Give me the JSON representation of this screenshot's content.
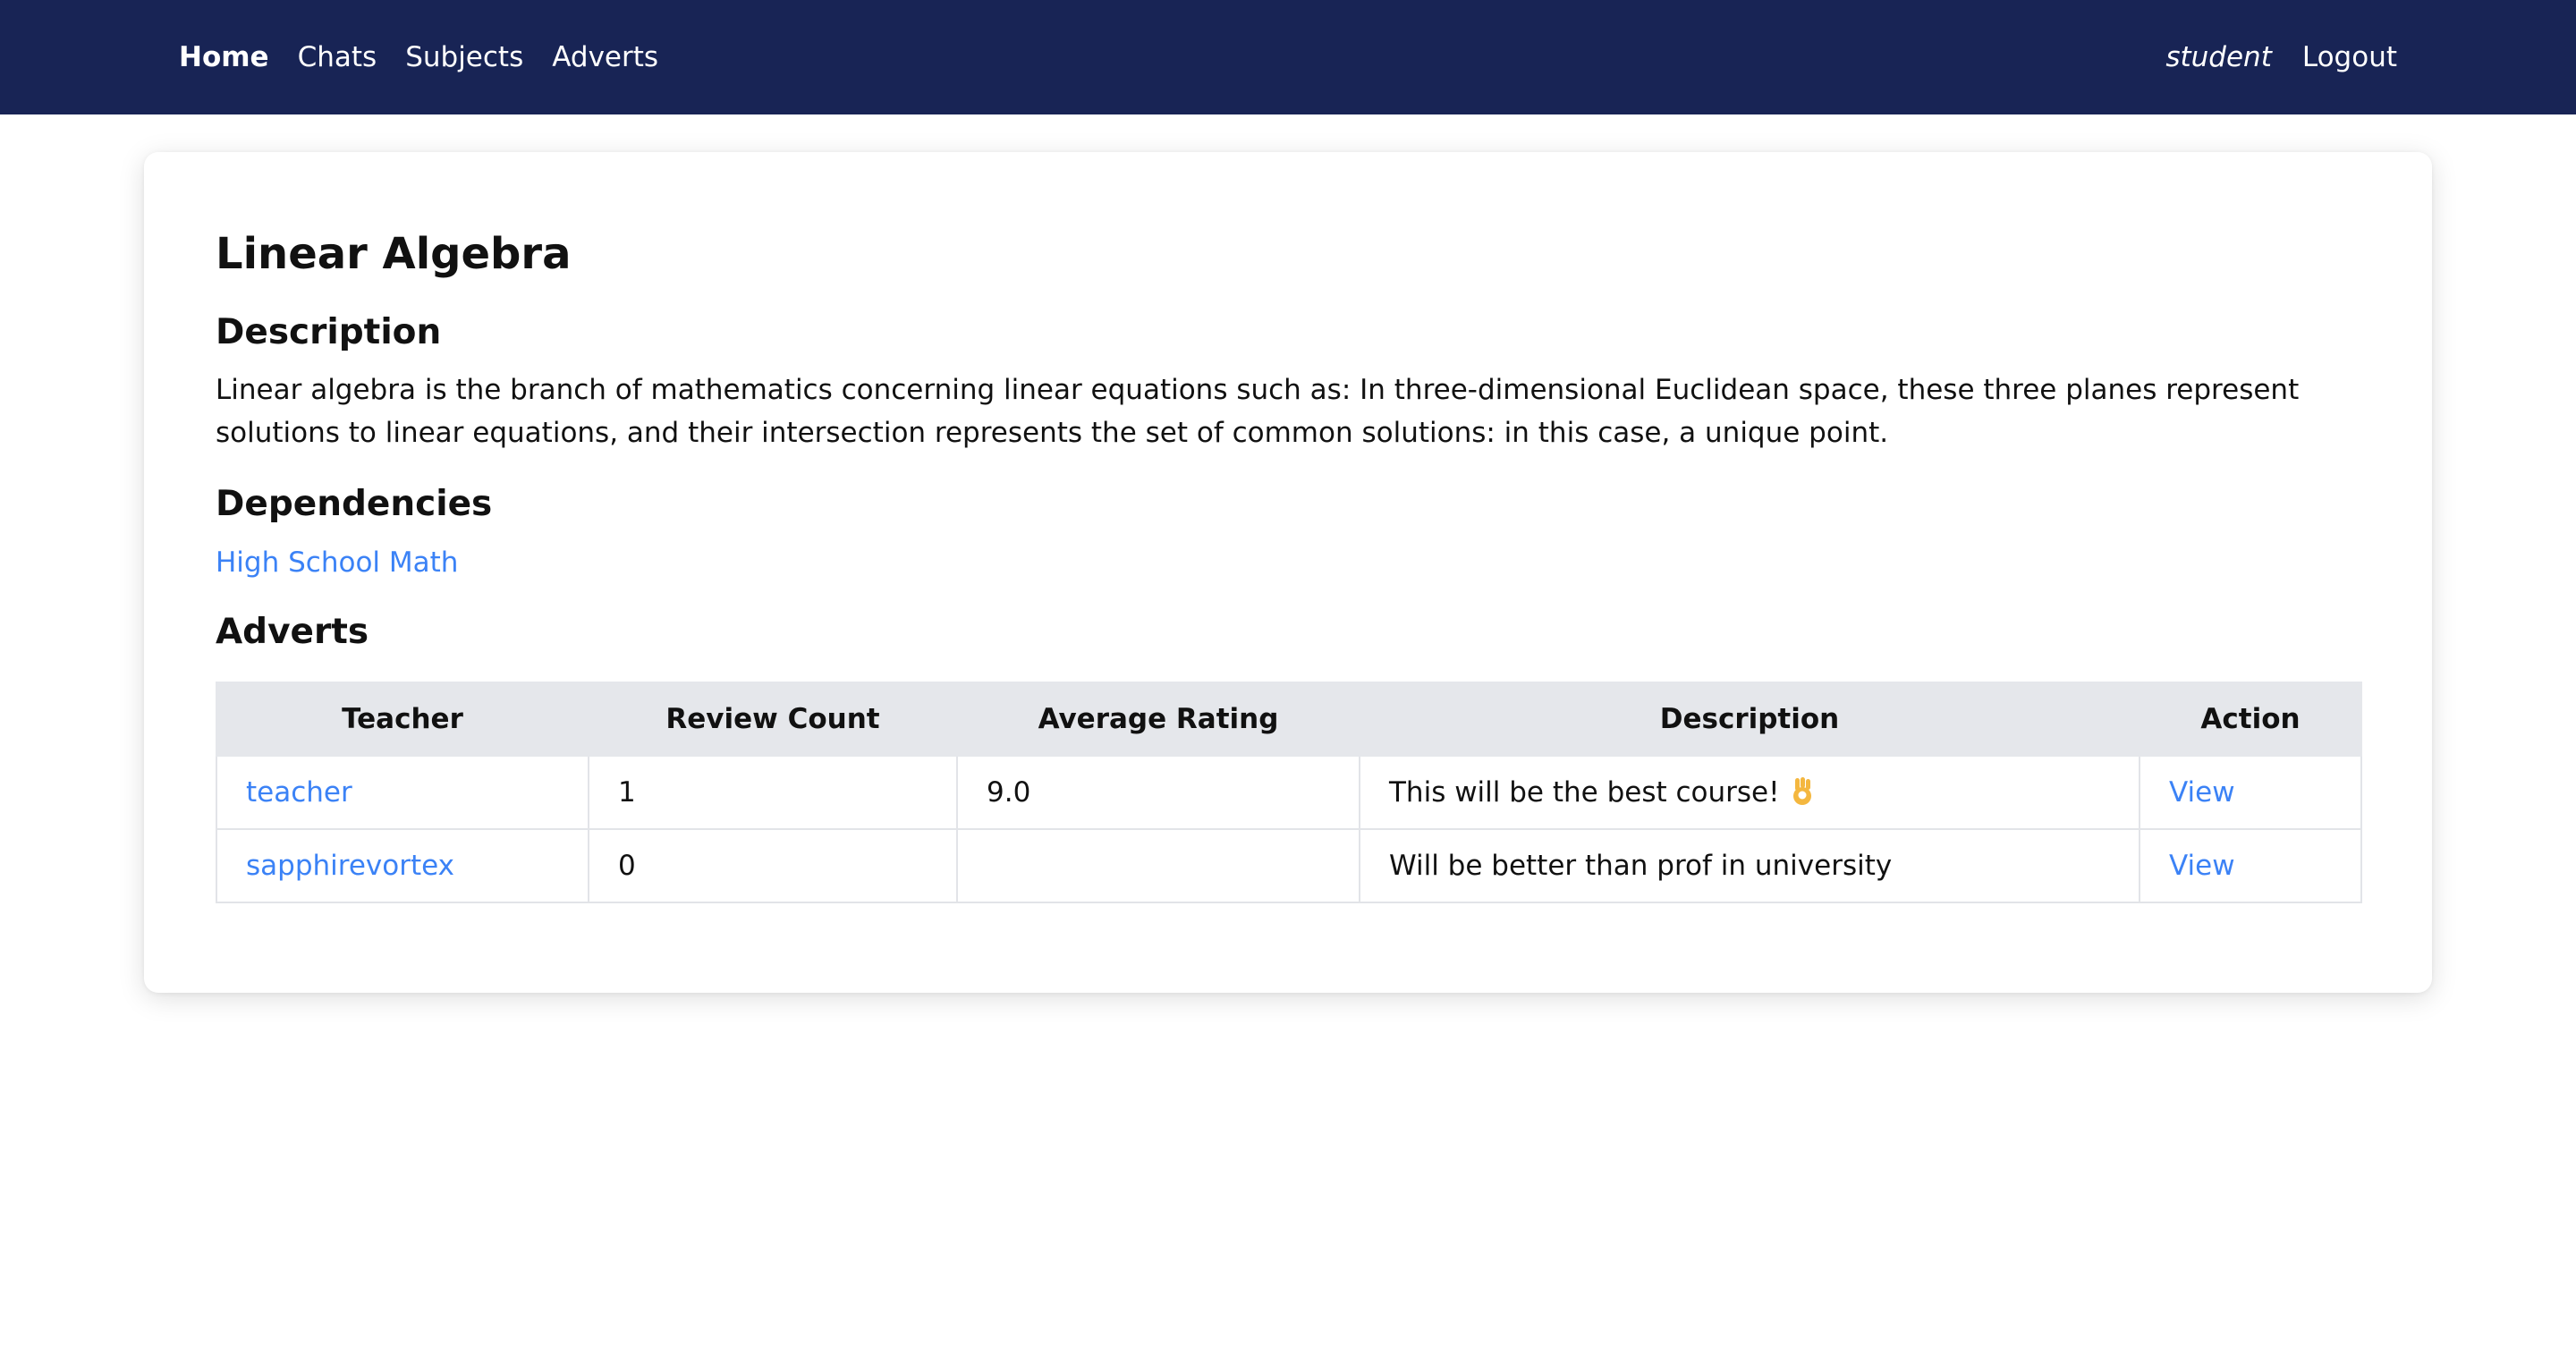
{
  "nav": {
    "links": [
      {
        "label": "Home",
        "active": true
      },
      {
        "label": "Chats",
        "active": false
      },
      {
        "label": "Subjects",
        "active": false
      },
      {
        "label": "Adverts",
        "active": false
      }
    ],
    "user": "student",
    "logout": "Logout",
    "background_color": "#182455"
  },
  "subject": {
    "title": "Linear Algebra",
    "description_heading": "Description",
    "description": "Linear algebra is the branch of mathematics concerning linear equations such as: In three-dimensional Euclidean space, these three planes represent solutions to linear equations, and their intersection represents the set of common solutions: in this case, a unique point.",
    "dependencies_heading": "Dependencies",
    "dependencies": [
      "High School Math"
    ],
    "adverts_heading": "Adverts"
  },
  "adverts_table": {
    "columns": [
      "Teacher",
      "Review Count",
      "Average Rating",
      "Description",
      "Action"
    ],
    "rows": [
      {
        "teacher": "teacher",
        "review_count": "1",
        "average_rating": "9.0",
        "description": "This will be the best course!",
        "description_icon": "ok-hand-emoji-icon",
        "action": "View"
      },
      {
        "teacher": "sapphirevortex",
        "review_count": "0",
        "average_rating": "",
        "description": "Will be better than prof in university",
        "action": "View"
      }
    ]
  },
  "colors": {
    "link": "#3b82f6",
    "table_header_bg": "#e5e7eb"
  }
}
